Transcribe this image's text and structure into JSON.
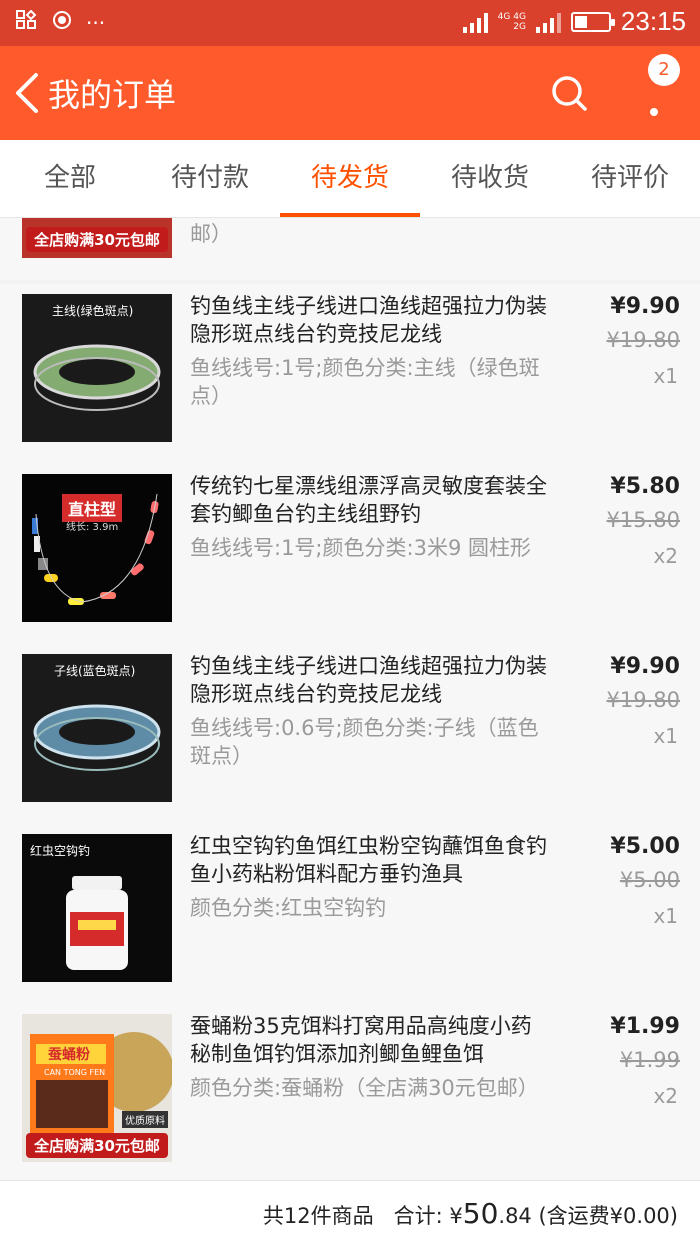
{
  "statusbar": {
    "time": "23:15",
    "net_top": "4G 4G",
    "net_bottom": "2G"
  },
  "header": {
    "title": "我的订单",
    "badge": "2"
  },
  "tabs": [
    "全部",
    "待付款",
    "待发货",
    "待收货",
    "待评价"
  ],
  "active_tab_index": 2,
  "partial_item": {
    "tail_text": "邮）",
    "promo": "全店购满30元包邮"
  },
  "items": [
    {
      "title": "钓鱼线主线子线进口渔线超强拉力伪装隐形斑点线台钓竞技尼龙线",
      "spec": "鱼线线号:1号;颜色分类:主线（绿色斑点）",
      "price": "¥9.90",
      "orig": "¥19.80",
      "qty": "x1",
      "thumb_text": "主线(绿色斑点)"
    },
    {
      "title": "传统钓七星漂线组漂浮高灵敏度套装全套钓鲫鱼台钓主线组野钓",
      "spec": "鱼线线号:1号;颜色分类:3米9 圆柱形",
      "price": "¥5.80",
      "orig": "¥15.80",
      "qty": "x2",
      "thumb_text": "直柱型",
      "thumb_sub": "线长: 3.9m"
    },
    {
      "title": "钓鱼线主线子线进口渔线超强拉力伪装隐形斑点线台钓竞技尼龙线",
      "spec": "鱼线线号:0.6号;颜色分类:子线（蓝色斑点）",
      "price": "¥9.90",
      "orig": "¥19.80",
      "qty": "x1",
      "thumb_text": "子线(蓝色斑点)"
    },
    {
      "title": "红虫空钩钓鱼饵红虫粉空钩蘸饵鱼食钓鱼小药粘粉饵料配方垂钓渔具",
      "spec": "颜色分类:红虫空钩钓",
      "price": "¥5.00",
      "orig": "¥5.00",
      "qty": "x1",
      "thumb_text": "红虫空钩钓"
    },
    {
      "title": "蚕蛹粉35克饵料打窝用品高纯度小药秘制鱼饵钓饵添加剂鲫鱼鲤鱼饵",
      "spec": "颜色分类:蚕蛹粉（全店满30元包邮）",
      "price": "¥1.99",
      "orig": "¥1.99",
      "qty": "x2",
      "thumb_text": "蚕蛹粉",
      "promo": "全店购满30元包邮",
      "thumb_sub": "CAN TONG FEN",
      "tag": "优质原料"
    }
  ],
  "footer": {
    "count": "共12件商品",
    "total_label": "合计:",
    "currency": "¥",
    "total_int": "50",
    "total_dec": ".84",
    "shipping": "(含运费¥0.00)"
  }
}
